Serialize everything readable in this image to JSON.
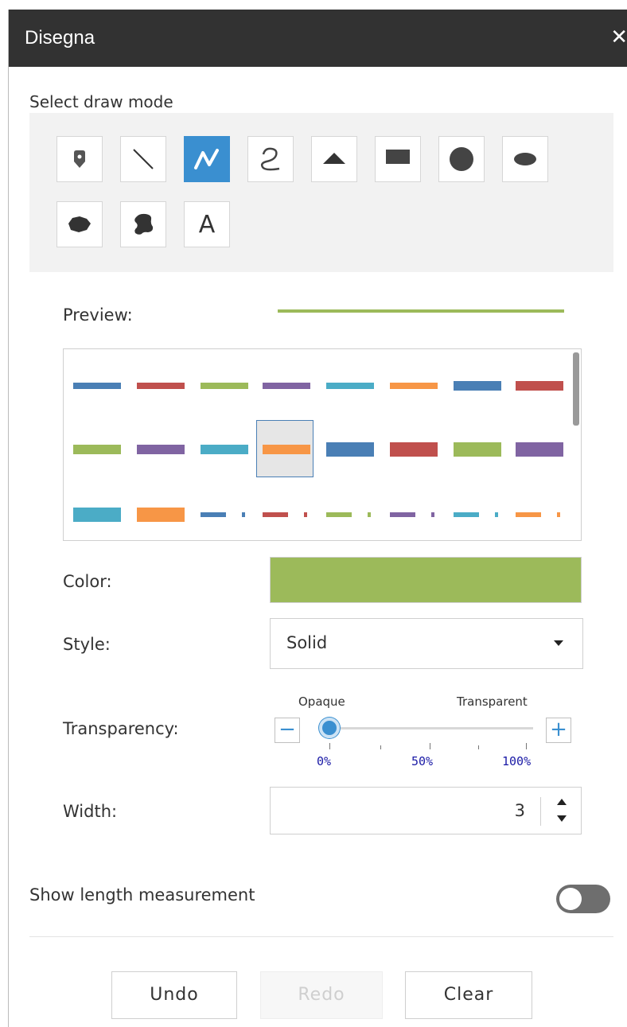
{
  "window": {
    "title": "Disegna",
    "close_glyph": "✕"
  },
  "draw_mode": {
    "label": "Select draw mode",
    "modes": [
      {
        "name": "point",
        "icon": "map-pin-icon",
        "active": false
      },
      {
        "name": "line",
        "icon": "line-icon",
        "active": false
      },
      {
        "name": "polyline",
        "icon": "polyline-icon",
        "active": true
      },
      {
        "name": "freehand-line",
        "icon": "freehand-line-icon",
        "active": false
      },
      {
        "name": "triangle",
        "icon": "triangle-icon",
        "active": false
      },
      {
        "name": "rectangle",
        "icon": "rectangle-icon",
        "active": false
      },
      {
        "name": "circle",
        "icon": "circle-icon",
        "active": false
      },
      {
        "name": "ellipse",
        "icon": "ellipse-icon",
        "active": false
      },
      {
        "name": "polygon",
        "icon": "polygon-icon",
        "active": false
      },
      {
        "name": "freehand-polygon",
        "icon": "freehand-polygon-icon",
        "active": false
      },
      {
        "name": "text",
        "icon": "text-icon",
        "active": false,
        "glyph": "A"
      }
    ]
  },
  "preview": {
    "label": "Preview:",
    "color": "#9cba5a"
  },
  "line_symbols": {
    "selected_index": 11,
    "palette": [
      "#4a7fb5",
      "#c0504d",
      "#9cba5a",
      "#8064a2",
      "#4bacc6",
      "#f79646"
    ]
  },
  "color": {
    "label": "Color:",
    "value": "#9cba5a"
  },
  "style": {
    "label": "Style:",
    "value": "Solid"
  },
  "transparency": {
    "label": "Transparency:",
    "left_caption": "Opaque",
    "right_caption": "Transparent",
    "minus": "−",
    "plus": "+",
    "value_percent": 0,
    "tick_labels": [
      "0%",
      "50%",
      "100%"
    ]
  },
  "width": {
    "label": "Width:",
    "value": "3"
  },
  "measurement": {
    "label": "Show length measurement",
    "enabled": false
  },
  "actions": {
    "undo": "Undo",
    "redo": "Redo",
    "clear": "Clear"
  },
  "accent_color": "#3a8fd0"
}
